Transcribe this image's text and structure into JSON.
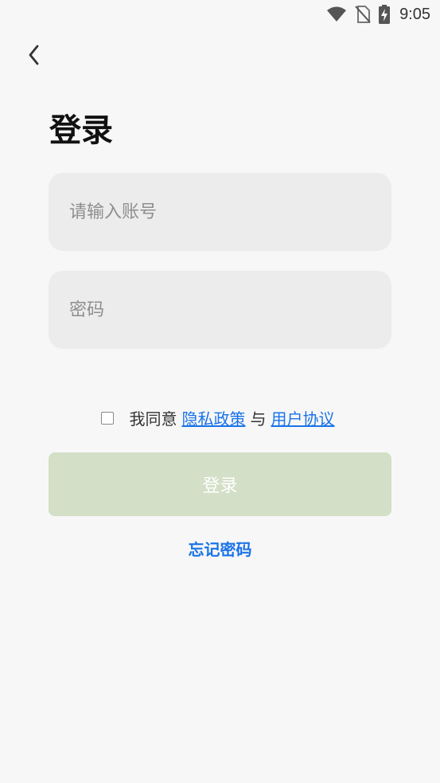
{
  "status_bar": {
    "time": "9:05",
    "icons": [
      "wifi-icon",
      "no-sim-icon",
      "battery-charging-icon"
    ]
  },
  "nav": {
    "back_icon": "chevron-left-icon"
  },
  "title": "登录",
  "form": {
    "account_placeholder": "请输入账号",
    "password_placeholder": "密码",
    "account_value": "",
    "password_value": ""
  },
  "agreement": {
    "checked": false,
    "prefix": "我同意",
    "privacy_link": "隐私政策",
    "connector": "与",
    "terms_link": "用户协议"
  },
  "login_button": {
    "label": "登录",
    "enabled": false
  },
  "forgot_password": "忘记密码",
  "colors": {
    "background": "#f7f7f7",
    "input_bg": "#ececec",
    "button_disabled": "#d3dfc7",
    "link": "#1a73e8"
  }
}
